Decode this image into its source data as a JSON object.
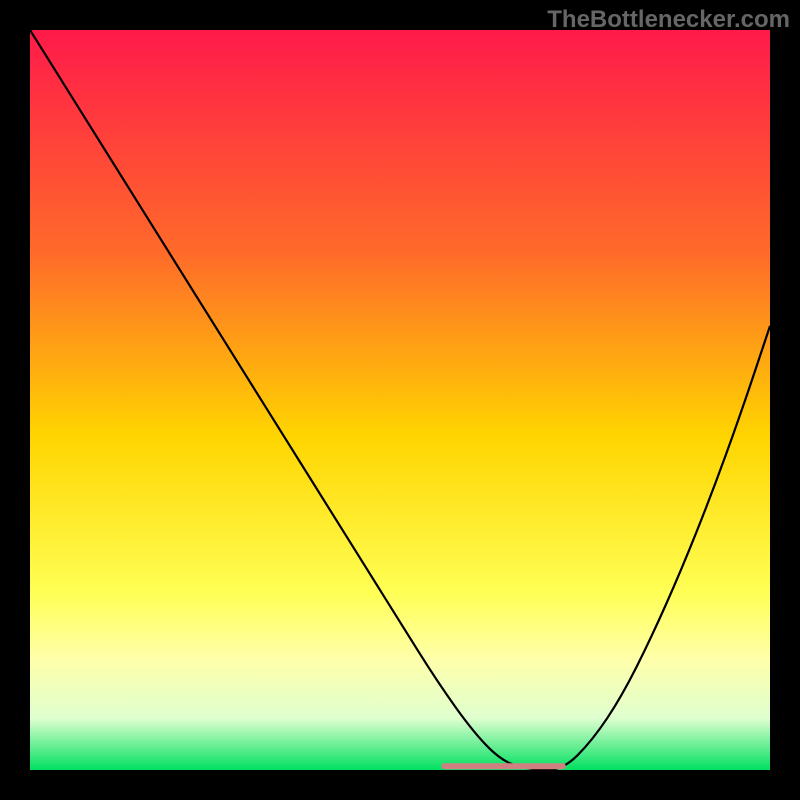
{
  "watermark": "TheBottlenecker.com",
  "chart_data": {
    "type": "line",
    "title": "",
    "xlabel": "",
    "ylabel": "",
    "xlim": [
      0,
      100
    ],
    "ylim": [
      0,
      100
    ],
    "gradient_stops": [
      {
        "offset": 0,
        "color": "#ff1a4a"
      },
      {
        "offset": 30,
        "color": "#ff6a2a"
      },
      {
        "offset": 55,
        "color": "#ffd500"
      },
      {
        "offset": 76,
        "color": "#ffff55"
      },
      {
        "offset": 85,
        "color": "#ffffaa"
      },
      {
        "offset": 93,
        "color": "#dfffcf"
      },
      {
        "offset": 100,
        "color": "#00e060"
      }
    ],
    "series": [
      {
        "name": "curve",
        "x": [
          0,
          5,
          10,
          15,
          20,
          25,
          30,
          35,
          40,
          45,
          50,
          55,
          60,
          64,
          68,
          72,
          76,
          80,
          84,
          88,
          92,
          96,
          100
        ],
        "values": [
          100,
          92,
          84,
          76,
          68,
          60,
          52,
          44,
          36,
          28,
          20,
          12,
          5,
          1,
          0,
          0,
          4,
          10,
          18,
          27,
          37,
          48,
          60
        ]
      }
    ],
    "flat_segment": {
      "x_start": 56,
      "x_end": 72,
      "y": 0.5,
      "color": "#d08080",
      "width": 6
    }
  }
}
